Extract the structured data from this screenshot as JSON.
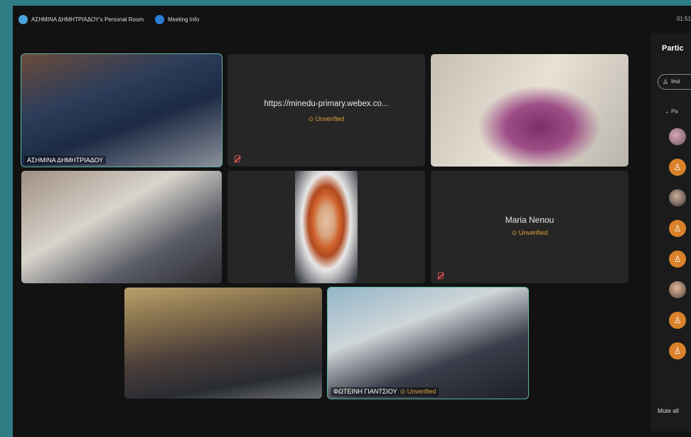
{
  "topbar": {
    "room_title": "ΑΣΗΜΙΝΑ ΔΗΜΗΤΡΙΑΔΟΥ's Personal Room",
    "meeting_info": "Meeting Info",
    "clock": "01:51"
  },
  "tiles": [
    {
      "name": "ΑΣΗΜΙΝΑ ΔΗΜΗΤΡΙΑΔΟΥ"
    },
    {
      "url": "https://minedu-primary.webex.co...",
      "status": "Unverified"
    },
    {
      "name": ""
    },
    {
      "name": ""
    },
    {
      "name": ""
    },
    {
      "name": "Maria Nenou",
      "status": "Unverified"
    },
    {
      "name": ""
    },
    {
      "name": "ΦΩΤΕΙΝΗ ΓΙΑΝΤΣΙΟΥ",
      "status": "Unverified"
    }
  ],
  "sidebar": {
    "title": "Partic",
    "invite_label": "Invi",
    "section_label": "Pa",
    "mute_all_label": "Mute all"
  },
  "colors": {
    "accent_active": "#5fb3a4",
    "unverified": "#e0a23a",
    "avatar_orange": "#d9822b"
  }
}
